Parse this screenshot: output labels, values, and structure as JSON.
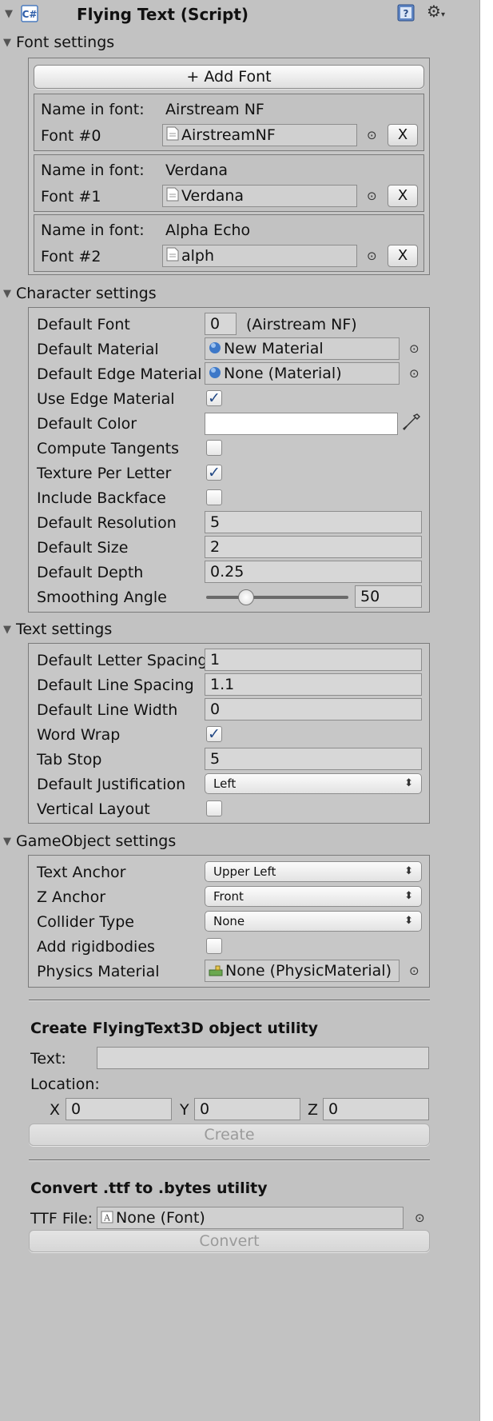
{
  "header": {
    "title": "Flying Text (Script)"
  },
  "font_settings": {
    "section_label": "Font settings",
    "add_font_label": "+ Add Font",
    "name_in_font_label": "Name in font:",
    "fonts": [
      {
        "label": "Font #0",
        "name": "Airstream NF",
        "asset": "AirstreamNF"
      },
      {
        "label": "Font #1",
        "name": "Verdana",
        "asset": "Verdana"
      },
      {
        "label": "Font #2",
        "name": "Alpha Echo",
        "asset": "alph"
      }
    ],
    "remove_label": "X"
  },
  "character_settings": {
    "section_label": "Character settings",
    "default_font_label": "Default Font",
    "default_font_value": "0",
    "default_font_note": "(Airstream NF)",
    "default_material_label": "Default Material",
    "default_material_value": "New Material",
    "default_edge_material_label": "Default Edge Material",
    "default_edge_material_value": "None (Material)",
    "use_edge_material_label": "Use Edge Material",
    "use_edge_material_checked": true,
    "default_color_label": "Default Color",
    "default_color_value": "#ffffff",
    "compute_tangents_label": "Compute Tangents",
    "compute_tangents_checked": false,
    "texture_per_letter_label": "Texture Per Letter",
    "texture_per_letter_checked": true,
    "include_backface_label": "Include Backface",
    "include_backface_checked": false,
    "default_resolution_label": "Default Resolution",
    "default_resolution_value": "5",
    "default_size_label": "Default Size",
    "default_size_value": "2",
    "default_depth_label": "Default Depth",
    "default_depth_value": "0.25",
    "smoothing_angle_label": "Smoothing Angle",
    "smoothing_angle_value": "50",
    "smoothing_angle_fraction": 0.28
  },
  "text_settings": {
    "section_label": "Text settings",
    "letter_spacing_label": "Default Letter Spacing",
    "letter_spacing_value": "1",
    "line_spacing_label": "Default Line Spacing",
    "line_spacing_value": "1.1",
    "line_width_label": "Default Line Width",
    "line_width_value": "0",
    "word_wrap_label": "Word Wrap",
    "word_wrap_checked": true,
    "tab_stop_label": "Tab Stop",
    "tab_stop_value": "5",
    "justification_label": "Default Justification",
    "justification_value": "Left",
    "vertical_layout_label": "Vertical Layout",
    "vertical_layout_checked": false
  },
  "gameobject_settings": {
    "section_label": "GameObject settings",
    "text_anchor_label": "Text Anchor",
    "text_anchor_value": "Upper Left",
    "z_anchor_label": "Z Anchor",
    "z_anchor_value": "Front",
    "collider_type_label": "Collider Type",
    "collider_type_value": "None",
    "add_rigidbodies_label": "Add rigidbodies",
    "add_rigidbodies_checked": false,
    "physics_material_label": "Physics Material",
    "physics_material_value": "None (PhysicMaterial)"
  },
  "create_utility": {
    "title": "Create FlyingText3D object utility",
    "text_label": "Text:",
    "text_value": "",
    "location_label": "Location:",
    "x_label": "X",
    "x_value": "0",
    "y_label": "Y",
    "y_value": "0",
    "z_label": "Z",
    "z_value": "0",
    "create_label": "Create"
  },
  "convert_utility": {
    "title": "Convert .ttf to .bytes utility",
    "ttf_label": "TTF File:",
    "ttf_value": "None (Font)",
    "convert_label": "Convert"
  },
  "colors": {
    "panel_bg": "#c2c2c2",
    "check_blue": "#244a86",
    "material_sphere": "#3d78c8"
  }
}
